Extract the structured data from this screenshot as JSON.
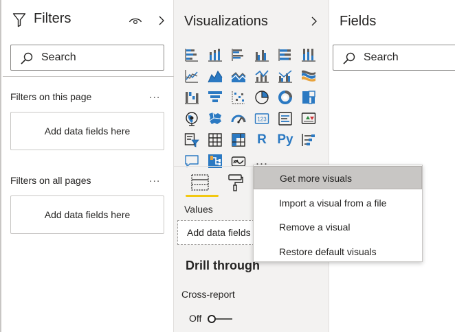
{
  "filters": {
    "title": "Filters",
    "search_placeholder": "Search",
    "sections": [
      {
        "label": "Filters on this page",
        "more": "...",
        "dropzone": "Add data fields here"
      },
      {
        "label": "Filters on all pages",
        "more": "...",
        "dropzone": "Add data fields here"
      }
    ]
  },
  "visualizations": {
    "title": "Visualizations",
    "icons": [
      "stacked-bar-chart-icon",
      "stacked-column-chart-icon",
      "clustered-bar-chart-icon",
      "clustered-column-chart-icon",
      "100-stacked-bar-chart-icon",
      "100-stacked-column-chart-icon",
      "line-chart-icon",
      "area-chart-icon",
      "stacked-area-chart-icon",
      "line-and-stacked-column-chart-icon",
      "line-and-clustered-column-chart-icon",
      "ribbon-chart-icon",
      "waterfall-chart-icon",
      "funnel-chart-icon",
      "scatter-chart-icon",
      "pie-chart-icon",
      "donut-chart-icon",
      "treemap-icon",
      "map-icon",
      "filled-map-icon",
      "gauge-icon",
      "card-icon",
      "multi-row-card-icon",
      "kpi-icon",
      "slicer-icon",
      "table-icon",
      "matrix-icon",
      "r-script-visual-icon",
      "python-visual-icon",
      "key-influencers-icon",
      "q-and-a-icon",
      "decomposition-tree-icon",
      "smart-narrative-icon",
      "more-visuals-icon"
    ],
    "r_label": "R",
    "py_label": "Py",
    "more_label": "...",
    "values_label": "Values",
    "values_dropzone": "Add data fields here",
    "drill_through_heading": "Drill through",
    "cross_report_label": "Cross-report",
    "cross_report_state": "Off"
  },
  "fields": {
    "title": "Fields",
    "search_placeholder": "Search"
  },
  "context_menu": {
    "items": [
      "Get more visuals",
      "Import a visual from a file",
      "Remove a visual",
      "Restore default visuals"
    ],
    "hovered_index": 0
  },
  "colors": {
    "accent_blue": "#2b79c2",
    "tab_underline": "#f2c811",
    "pane_bg": "#f3f2f1"
  }
}
